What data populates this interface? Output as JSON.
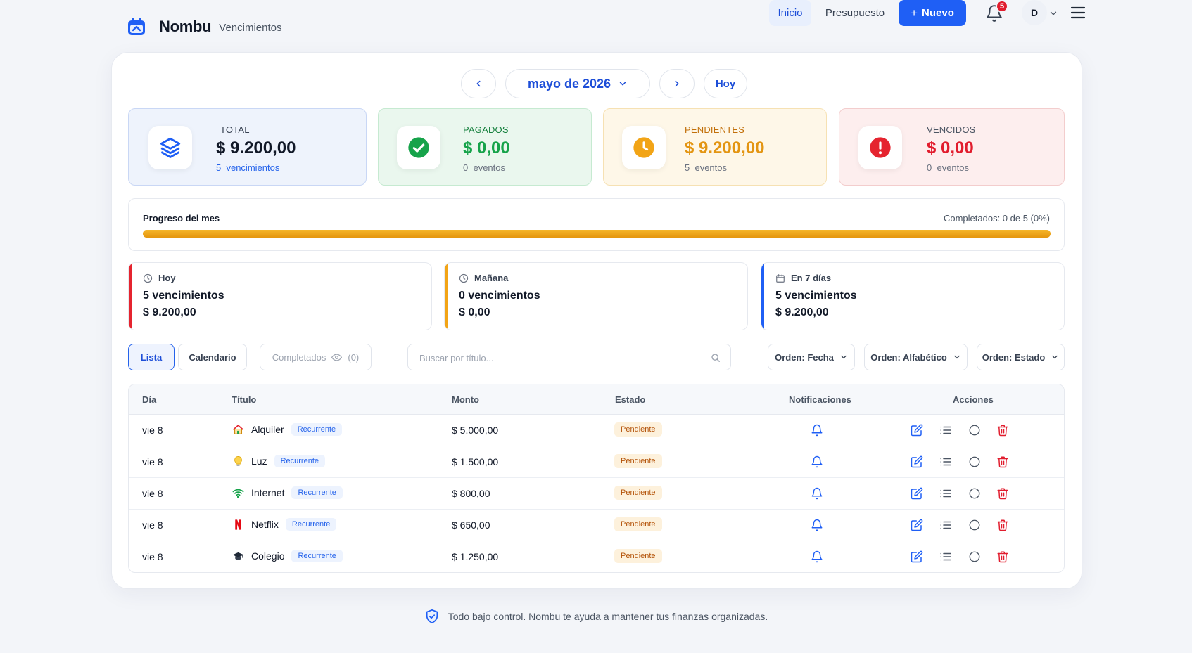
{
  "brand": {
    "name": "Nombu",
    "section": "Vencimientos"
  },
  "nav": {
    "inicio": "Inicio",
    "presupuesto": "Presupuesto",
    "nuevo": "Nuevo",
    "notif_count": "5",
    "avatar": "D"
  },
  "month_nav": {
    "label": "mayo de 2026",
    "today": "Hoy"
  },
  "stats": {
    "total": {
      "label": "TOTAL",
      "value": "$ 9.200,00",
      "sub_count": "5",
      "sub_text": "vencimientos"
    },
    "pagados": {
      "label": "PAGADOS",
      "value": "$ 0,00",
      "sub_count": "0",
      "sub_text": "eventos"
    },
    "pendientes": {
      "label": "PENDIENTES",
      "value": "$ 9.200,00",
      "sub_count": "5",
      "sub_text": "eventos"
    },
    "vencidos": {
      "label": "VENCIDOS",
      "value": "$ 0,00",
      "sub_count": "0",
      "sub_text": "eventos"
    }
  },
  "progress": {
    "title": "Progreso del mes",
    "completed_text": "Completados: 0 de 5 (0%)",
    "fill_fraction": 1.0
  },
  "upcoming": [
    {
      "label": "Hoy",
      "count": "5 vencimientos",
      "amount": "$ 9.200,00",
      "color": "#e5242f"
    },
    {
      "label": "Mañana",
      "count": "0 vencimientos",
      "amount": "$ 0,00",
      "color": "#f2a416"
    },
    {
      "label": "En 7 días",
      "count": "5 vencimientos",
      "amount": "$ 9.200,00",
      "color": "#1f5ff5"
    }
  ],
  "controls": {
    "tab_lista": "Lista",
    "tab_calendario": "Calendario",
    "completados_label": "Completados",
    "completados_count": "(0)",
    "search_placeholder": "Buscar por título...",
    "sort_fecha": "Orden: Fecha",
    "sort_alfabetico": "Orden: Alfabético",
    "sort_estado": "Orden: Estado"
  },
  "table": {
    "headers": {
      "dia": "Día",
      "titulo": "Título",
      "monto": "Monto",
      "estado": "Estado",
      "notificaciones": "Notificaciones",
      "acciones": "Acciones"
    },
    "rows": [
      {
        "dia": "vie 8",
        "titulo": "Alquiler",
        "icon": "house-icon",
        "badge": "Recurrente",
        "monto": "$ 5.000,00",
        "estado": "Pendiente"
      },
      {
        "dia": "vie 8",
        "titulo": "Luz",
        "icon": "lightbulb-icon",
        "badge": "Recurrente",
        "monto": "$ 1.500,00",
        "estado": "Pendiente"
      },
      {
        "dia": "vie 8",
        "titulo": "Internet",
        "icon": "wifi-icon",
        "badge": "Recurrente",
        "monto": "$ 800,00",
        "estado": "Pendiente"
      },
      {
        "dia": "vie 8",
        "titulo": "Netflix",
        "icon": "netflix-icon",
        "badge": "Recurrente",
        "monto": "$ 650,00",
        "estado": "Pendiente"
      },
      {
        "dia": "vie 8",
        "titulo": "Colegio",
        "icon": "graduation-cap-icon",
        "badge": "Recurrente",
        "monto": "$ 1.250,00",
        "estado": "Pendiente"
      }
    ]
  },
  "footer": {
    "text": "Todo bajo control. Nombu te ayuda a mantener tus finanzas organizadas."
  },
  "colors": {
    "accent": "#1f5ff5",
    "success": "#16a34a",
    "warning": "#f2a416",
    "danger": "#e5242f"
  }
}
